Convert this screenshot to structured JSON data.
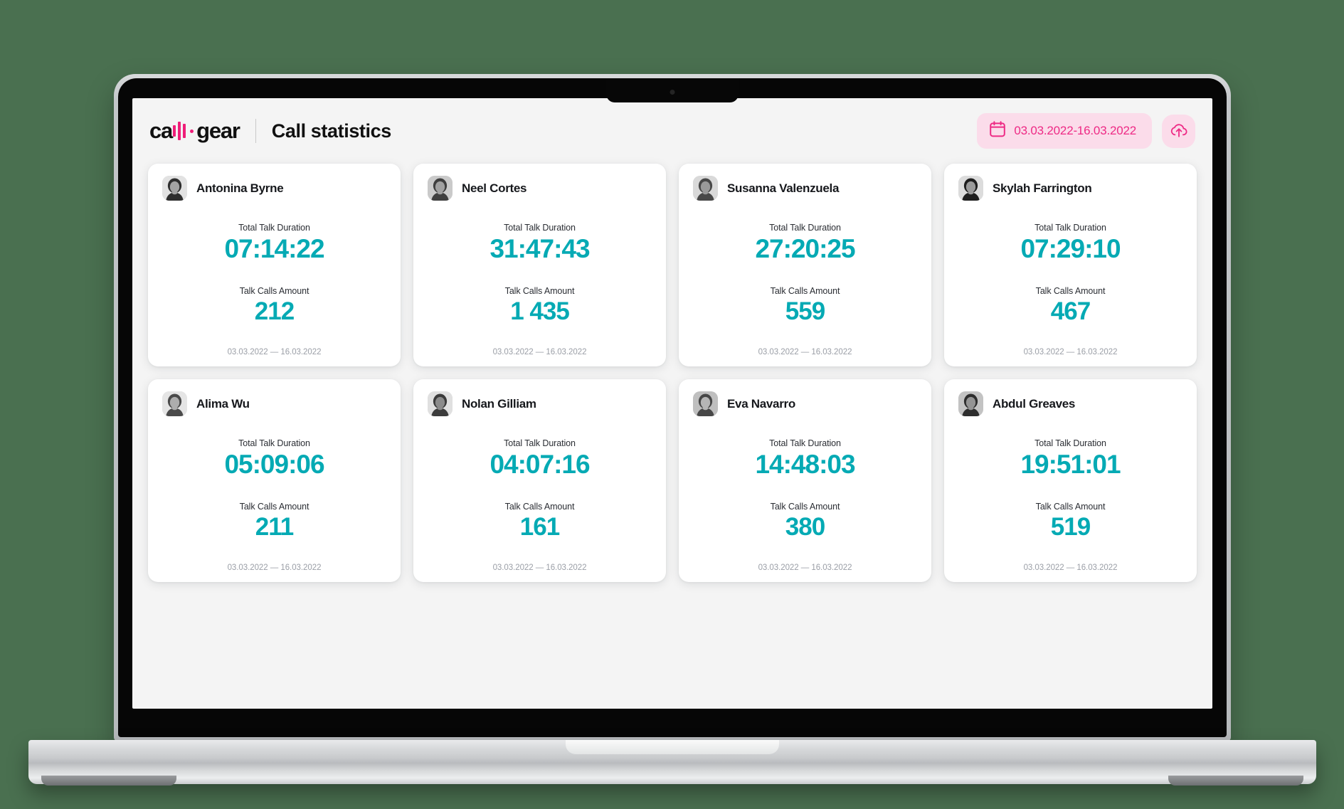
{
  "header": {
    "logo_text_left": "ca",
    "logo_text_right": "gear",
    "logo_icon": "callgear-bars-logo",
    "page_title": "Call statistics",
    "date_range": "03.03.2022-16.03.2022",
    "calendar_icon": "calendar-icon",
    "export_icon": "cloud-upload-icon",
    "accent_pink": "#ee2a85",
    "accent_pink_bg": "#fbdcea"
  },
  "labels": {
    "total_talk_duration": "Total Talk Duration",
    "talk_calls_amount": "Talk Calls Amount",
    "period": "03.03.2022 — 16.03.2022"
  },
  "colors": {
    "metric_teal": "#05aab4",
    "screen_bg": "#f4f4f4",
    "card_bg": "#ffffff",
    "page_bg": "#4a7050"
  },
  "cards": [
    {
      "name": "Antonina Byrne",
      "duration": "07:14:22",
      "calls": "212",
      "period": "03.03.2022 — 16.03.2022",
      "avatar": "avatar-antonina-byrne"
    },
    {
      "name": "Neel Cortes",
      "duration": "31:47:43",
      "calls": "1 435",
      "period": "03.03.2022 — 16.03.2022",
      "avatar": "avatar-neel-cortes"
    },
    {
      "name": "Susanna Valenzuela",
      "duration": "27:20:25",
      "calls": "559",
      "period": "03.03.2022 — 16.03.2022",
      "avatar": "avatar-susanna-valenzuela"
    },
    {
      "name": "Skylah Farrington",
      "duration": "07:29:10",
      "calls": "467",
      "period": "03.03.2022 — 16.03.2022",
      "avatar": "avatar-skylah-farrington"
    },
    {
      "name": "Alima Wu",
      "duration": "05:09:06",
      "calls": "211",
      "period": "03.03.2022 — 16.03.2022",
      "avatar": "avatar-alima-wu"
    },
    {
      "name": "Nolan Gilliam",
      "duration": "04:07:16",
      "calls": "161",
      "period": "03.03.2022 — 16.03.2022",
      "avatar": "avatar-nolan-gilliam"
    },
    {
      "name": "Eva Navarro",
      "duration": "14:48:03",
      "calls": "380",
      "period": "03.03.2022 — 16.03.2022",
      "avatar": "avatar-eva-navarro"
    },
    {
      "name": "Abdul Greaves",
      "duration": "19:51:01",
      "calls": "519",
      "period": "03.03.2022 — 16.03.2022",
      "avatar": "avatar-abdul-greaves"
    }
  ]
}
